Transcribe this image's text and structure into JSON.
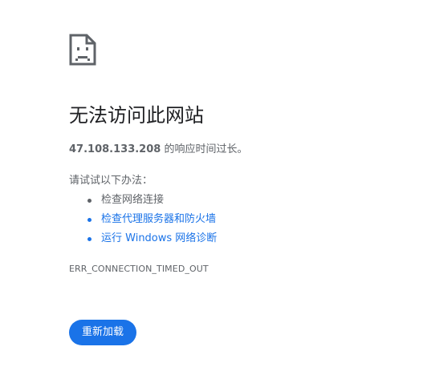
{
  "error_page": {
    "icon": "sad-page-icon",
    "title": "无法访问此网站",
    "summary": {
      "host": "47.108.133.208",
      "message": " 的响应时间过长。"
    },
    "suggestions": {
      "heading": "请试试以下办法：",
      "items": [
        {
          "label": "检查网络连接",
          "is_link": false
        },
        {
          "label": "检查代理服务器和防火墙",
          "is_link": true
        },
        {
          "label": "运行 Windows 网络诊断",
          "is_link": true
        }
      ]
    },
    "error_code": "ERR_CONNECTION_TIMED_OUT",
    "reload_label": "重新加载"
  },
  "colors": {
    "text_primary": "#202124",
    "text_secondary": "#5f6368",
    "link": "#1a73e8",
    "button_bg": "#1a73e8",
    "button_text": "#ffffff"
  }
}
